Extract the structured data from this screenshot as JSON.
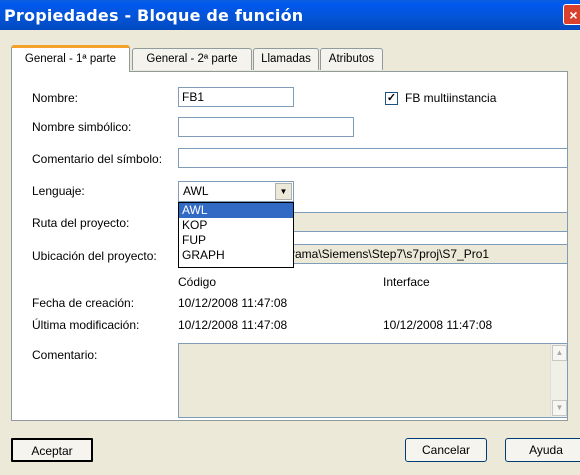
{
  "window": {
    "title": "Propiedades - Bloque de función",
    "close_glyph": "×"
  },
  "tabs": [
    {
      "label": "General - 1ª parte",
      "active": true
    },
    {
      "label": "General - 2ª parte",
      "active": false
    },
    {
      "label": "Llamadas",
      "active": false
    },
    {
      "label": "Atributos",
      "active": false
    }
  ],
  "form": {
    "nombre_label": "Nombre:",
    "nombre_value": "FB1",
    "multiinstancia_label": "FB multiinstancia",
    "multiinstancia_checked": true,
    "check_glyph": "✓",
    "simbolico_label": "Nombre simbólico:",
    "simbolico_value": "",
    "comentario_simbolo_label": "Comentario del símbolo:",
    "comentario_simbolo_value": "",
    "lenguaje_label": "Lenguaje:",
    "lenguaje_value": "AWL",
    "lenguaje_options": [
      "AWL",
      "KOP",
      "FUP",
      "GRAPH"
    ],
    "ruta_label": "Ruta del proyecto:",
    "ruta_value": "",
    "ubicacion_label": "Ubicación del proyecto:",
    "ubicacion_value": "rama\\Siemens\\Step7\\s7proj\\S7_Pro1",
    "codigo_header": "Código",
    "interface_header": "Interface",
    "fecha_creacion_label": "Fecha de creación:",
    "fecha_creacion_codigo": "10/12/2008  11:47:08",
    "ultima_mod_label": "Última modificación:",
    "ultima_mod_codigo": "10/12/2008  11:47:08",
    "ultima_mod_interface": "10/12/2008  11:47:08",
    "comentario_label": "Comentario:",
    "comentario_value": ""
  },
  "buttons": {
    "aceptar": "Aceptar",
    "cancelar": "Cancelar",
    "ayuda": "Ayuda"
  },
  "colors": {
    "titlebar": "#0453d4",
    "selection": "#316ac5",
    "tab_highlight": "#f3a12a"
  }
}
